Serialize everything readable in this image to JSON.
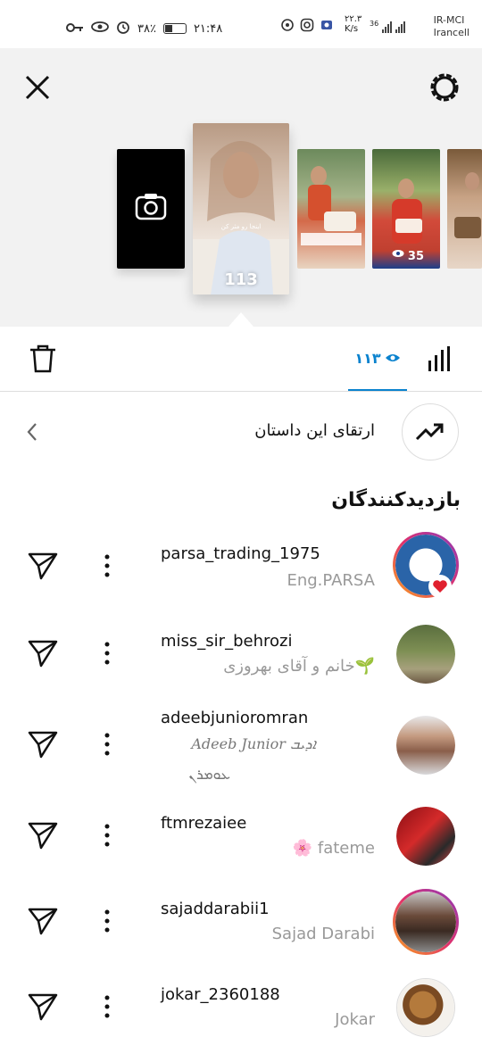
{
  "status_bar": {
    "time": "۲۱:۴۸",
    "battery": "۳۸٪",
    "speed_value": "۲۲.۳",
    "speed_unit": "K/s",
    "network": "36",
    "carrier_1": "IR-MCI",
    "carrier_2": "Irancell"
  },
  "stories": {
    "main_caption": "اینجا رو مثر کن",
    "main_view_count": "113",
    "side_view_count": "35"
  },
  "tabs": {
    "views_count": "۱۱۳"
  },
  "promote": {
    "label": "ارتقای این داستان"
  },
  "viewers": {
    "title": "بازدیدکنندگان",
    "items": [
      {
        "username": "parsa_trading_1975",
        "display_name": "Eng.PARSA"
      },
      {
        "username": "miss_sir_behrozi",
        "display_name": "خانم و آقای بهروزی🌱"
      },
      {
        "username": "adeebjunioromran",
        "display_name": "Adeeb Junior ܐܕܝܒ",
        "display_name_2": "ܥܘܡܪܢ"
      },
      {
        "username": "ftmrezaiee",
        "display_name": "🌸 fateme"
      },
      {
        "username": "sajaddarabii1",
        "display_name": "Sajad Darabi"
      },
      {
        "username": "jokar_2360188",
        "display_name": "Jokar"
      }
    ]
  },
  "colors": {
    "accent": "#0a82ce",
    "ring_gradient": [
      "#f9a51a",
      "#e1306c",
      "#8a3ab9"
    ],
    "heart": "#e0202e"
  }
}
